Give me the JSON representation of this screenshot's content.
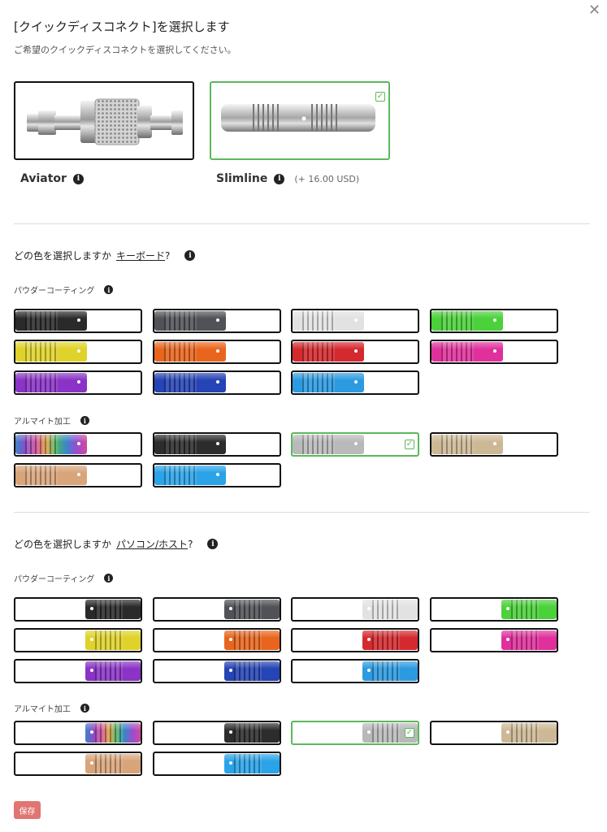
{
  "header": {
    "title": "[クイックディスコネクト]を選択します",
    "subtitle": "ご希望のクイックディスコネクトを選択してください。",
    "close_icon": "close-icon"
  },
  "connectors": [
    {
      "name": "Aviator",
      "price": "",
      "selected": false
    },
    {
      "name": "Slimline",
      "price": "(+ 16.00 USD)",
      "selected": true
    }
  ],
  "keyboard_section": {
    "question": "どの色を選択しますか",
    "link": "キーボード",
    "question_end": "?",
    "powder_label": "パウダーコーティング",
    "anodized_label": "アルマイト加工"
  },
  "host_section": {
    "question": "どの色を選択しますか",
    "link": "パソコン/ホスト",
    "question_end": "?",
    "powder_label": "パウダーコーティング",
    "anodized_label": "アルマイト加工"
  },
  "powder_colors": [
    "#2a2a2a",
    "#505257",
    "#e2e2e2",
    "#4bd13a",
    "#dfd22a",
    "#e8651e",
    "#d42a2f",
    "#e0309c",
    "#8a33c6",
    "#2544b5",
    "#2c9ae0"
  ],
  "anodized_colors": [
    "rainbow",
    "#2c2c2c",
    "#b9b9b9",
    "#cdb895",
    "#d8a47a",
    "#2aa3e8"
  ],
  "keyboard_selected_anodized_index": 2,
  "host_selected_anodized_index": 2,
  "save_label": "保存"
}
